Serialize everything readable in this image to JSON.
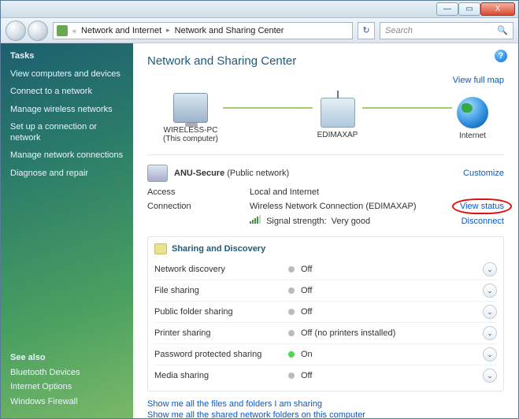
{
  "titlebar": {
    "min": "—",
    "max": "▭",
    "close": "X"
  },
  "addressbar": {
    "prefix": "«",
    "crumbs": [
      "Network and Internet",
      "Network and Sharing Center"
    ],
    "refresh": "↻"
  },
  "search": {
    "placeholder": "Search"
  },
  "sidebar": {
    "tasks_label": "Tasks",
    "tasks": [
      "View computers and devices",
      "Connect to a network",
      "Manage wireless networks",
      "Set up a connection or network",
      "Manage network connections",
      "Diagnose and repair"
    ],
    "seealso_label": "See also",
    "seealso": [
      "Bluetooth Devices",
      "Internet Options",
      "Windows Firewall"
    ]
  },
  "main": {
    "title": "Network and Sharing Center",
    "view_full_map": "View full map",
    "map": {
      "pc_name": "WIRELESS-PC",
      "pc_sub": "(This computer)",
      "ap_name": "EDIMAXAP",
      "internet": "Internet"
    },
    "network": {
      "name": "ANU-Secure",
      "type": "(Public network)",
      "customize": "Customize",
      "access_label": "Access",
      "access_value": "Local and Internet",
      "connection_label": "Connection",
      "connection_value_prefix": "Wireless Network Connection (",
      "connection_value_name": "EDIMAXAP",
      "connection_value_suffix": ")",
      "view_status": "View status",
      "signal_label": "Signal strength:",
      "signal_value": "Very good",
      "disconnect": "Disconnect"
    },
    "sharing": {
      "heading": "Sharing and Discovery",
      "rows": [
        {
          "label": "Network discovery",
          "value": "Off",
          "on": false
        },
        {
          "label": "File sharing",
          "value": "Off",
          "on": false
        },
        {
          "label": "Public folder sharing",
          "value": "Off",
          "on": false
        },
        {
          "label": "Printer sharing",
          "value": "Off (no printers installed)",
          "on": false
        },
        {
          "label": "Password protected sharing",
          "value": "On",
          "on": true
        },
        {
          "label": "Media sharing",
          "value": "Off",
          "on": false
        }
      ]
    },
    "footer": {
      "link1": "Show me all the files and folders I am sharing",
      "link2": "Show me all the shared network folders on this computer"
    }
  }
}
